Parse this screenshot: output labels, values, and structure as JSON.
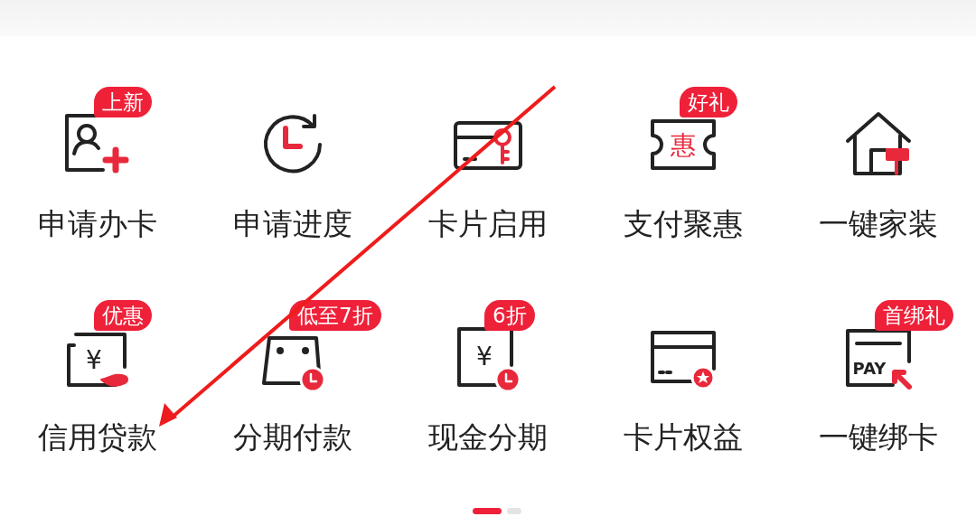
{
  "items": [
    {
      "label": "申请办卡",
      "badge": "上新"
    },
    {
      "label": "申请进度"
    },
    {
      "label": "卡片启用"
    },
    {
      "label": "支付聚惠",
      "badge": "好礼",
      "icon_text": "惠"
    },
    {
      "label": "一键家装"
    },
    {
      "label": "信用贷款",
      "badge": "优惠",
      "icon_text": "¥"
    },
    {
      "label": "分期付款",
      "badge": "低至7折"
    },
    {
      "label": "现金分期",
      "badge": "6折",
      "icon_text": "¥"
    },
    {
      "label": "卡片权益"
    },
    {
      "label": "一键绑卡",
      "badge": "首绑礼",
      "icon_text": "PAY"
    }
  ],
  "pagination": [
    {
      "selected": true
    },
    {
      "selected": false
    }
  ],
  "annotation": {
    "kind": "arrow"
  }
}
